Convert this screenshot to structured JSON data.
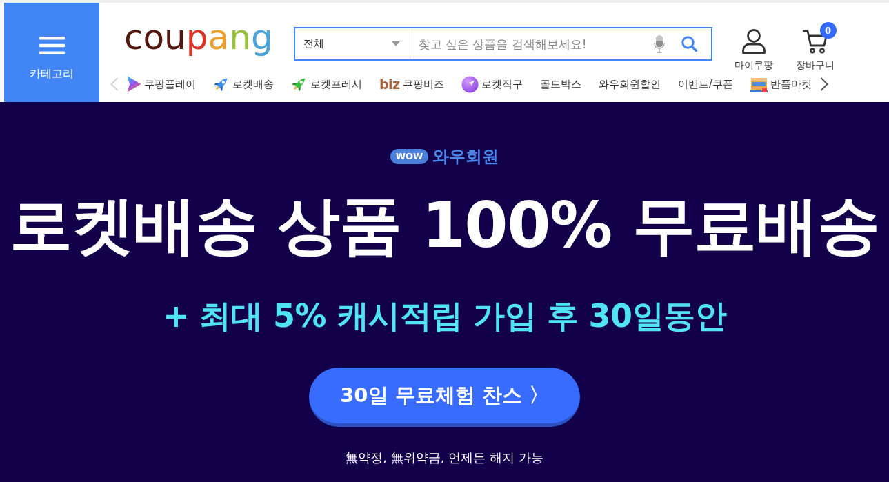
{
  "category_button": {
    "label": "카테고리"
  },
  "logo": {
    "parts": [
      {
        "text": "cou",
        "color": "#52170f"
      },
      {
        "text": "p",
        "color": "#d9352b"
      },
      {
        "text": "a",
        "color": "#e9a02e"
      },
      {
        "text": "n",
        "color": "#98c23d"
      },
      {
        "text": "g",
        "color": "#4ea5da"
      }
    ]
  },
  "search": {
    "category": "전체",
    "placeholder": "찾고 싶은 상품을 검색해보세요!"
  },
  "account_links": [
    {
      "kind": "user",
      "label": "마이쿠팡"
    },
    {
      "kind": "cart",
      "label": "장바구니",
      "badge": "0"
    }
  ],
  "nav": {
    "prev": {
      "disabled": true
    },
    "next": {
      "disabled": false
    },
    "items": [
      {
        "kind": "play",
        "label": "쿠팡플레이"
      },
      {
        "kind": "rocket",
        "label": "로켓배송"
      },
      {
        "kind": "fresh",
        "label": "로켓프레시"
      },
      {
        "kind": "text-logo",
        "logo": "biz",
        "label": "쿠팡비즈"
      },
      {
        "kind": "global",
        "label": "로켓직구"
      },
      {
        "kind": "plain",
        "label": "골드박스"
      },
      {
        "kind": "plain",
        "label": "와우회원할인"
      },
      {
        "kind": "plain",
        "label": "이벤트/쿠폰"
      },
      {
        "kind": "box",
        "label": "반품마켓"
      }
    ]
  },
  "banner": {
    "badge": "WOW",
    "membership": "와우회원",
    "headline": "로켓배송 상품 100% 무료배송",
    "subheadline": "+ 최대 5% 캐시적립 가입 후 30일동안",
    "cta": "30일 무료체험 찬스 〉",
    "note": "無약정, 無위약금, 언제든 해지 가능"
  }
}
